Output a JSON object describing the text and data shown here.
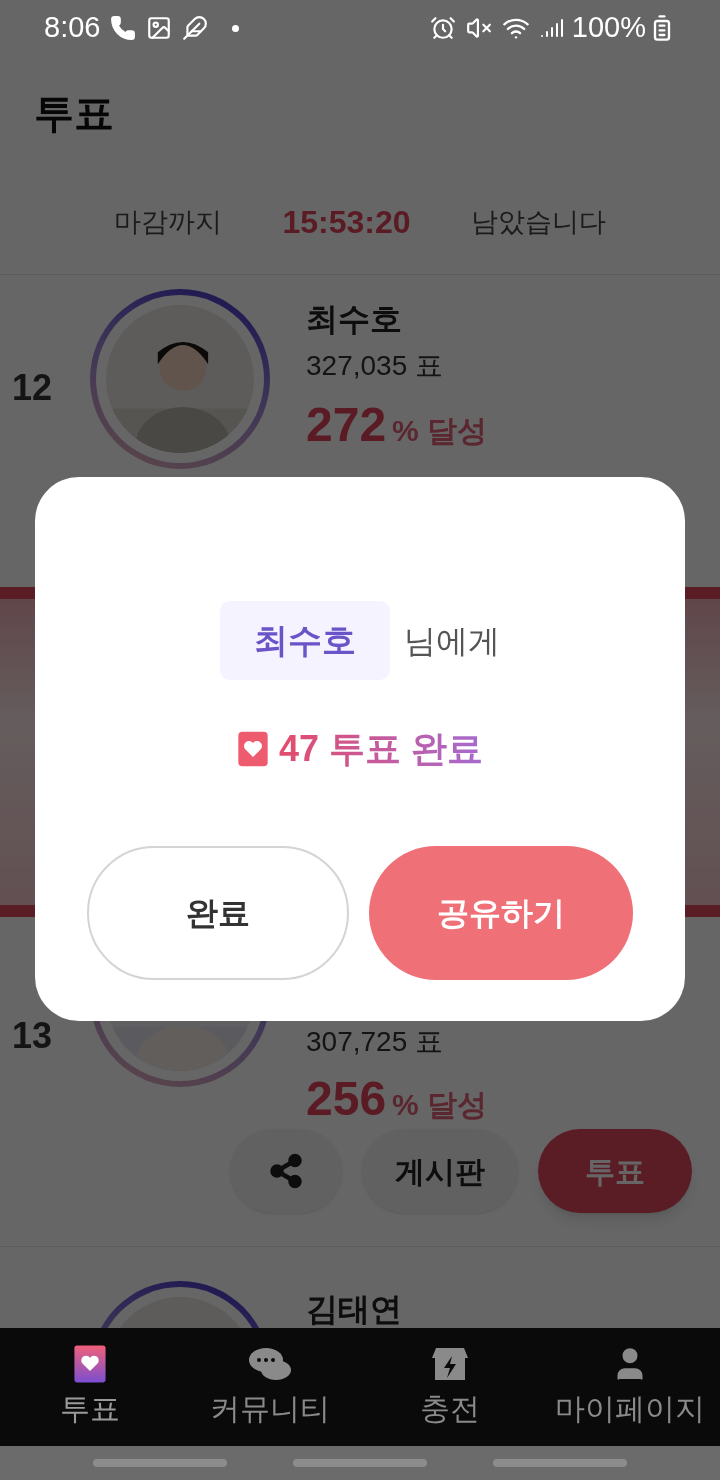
{
  "status_bar": {
    "time": "8:06",
    "battery": "100%"
  },
  "header": {
    "title": "투표"
  },
  "countdown": {
    "prefix": "마감까지",
    "time": "15:53:20",
    "suffix": "남았습니다"
  },
  "candidates": [
    {
      "rank": "12",
      "name": "최수호",
      "votes": "327,035 표",
      "percent": "272",
      "percent_suffix": "% 달성"
    },
    {
      "rank": "13",
      "votes": "307,725 표",
      "percent": "256",
      "percent_suffix": "% 달성",
      "actions": {
        "board": "게시판",
        "vote": "투표"
      }
    },
    {
      "name": "김태연"
    }
  ],
  "modal": {
    "recipient": "최수호",
    "recipient_suffix": "님에게",
    "result": "47 투표 완료",
    "buttons": [
      {
        "label": "완료",
        "kind": "secondary"
      },
      {
        "label": "공유하기",
        "kind": "primary"
      }
    ]
  },
  "bottom_nav": [
    {
      "label": "투표",
      "kind": "vote",
      "selected": true
    },
    {
      "label": "커뮤니티",
      "kind": "chat",
      "selected": false
    },
    {
      "label": "충전",
      "kind": "store",
      "selected": false
    },
    {
      "label": "마이페이지",
      "kind": "person",
      "selected": false
    }
  ]
}
